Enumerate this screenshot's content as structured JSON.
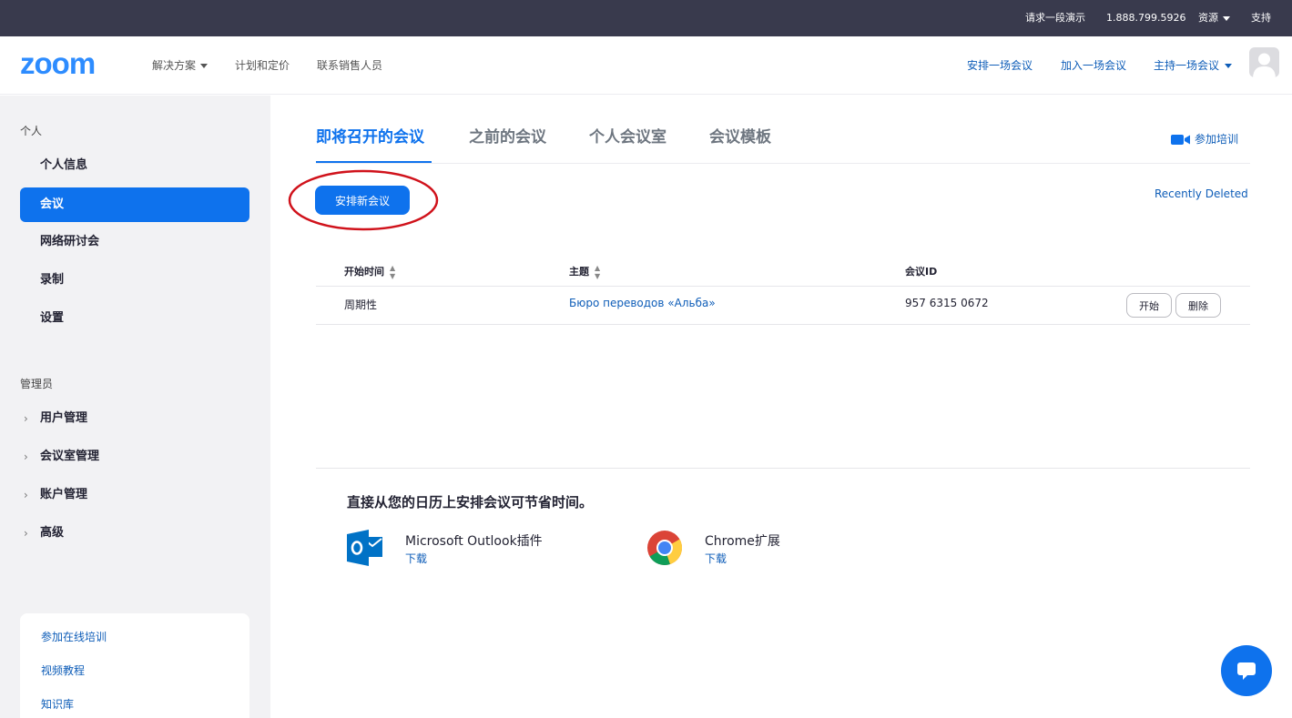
{
  "utility_bar": {
    "request_demo": "请求一段演示",
    "phone": "1.888.799.5926",
    "resources": "资源",
    "support": "支持"
  },
  "header": {
    "logo": "zoom",
    "nav": {
      "solutions": "解决方案",
      "plans": "计划和定价",
      "contact_sales": "联系销售人员"
    },
    "actions": {
      "schedule": "安排一场会议",
      "join": "加入一场会议",
      "host": "主持一场会议"
    }
  },
  "sidebar": {
    "personal_heading": "个人",
    "personal_items": [
      "个人信息",
      "会议",
      "网络研讨会",
      "录制",
      "设置"
    ],
    "active_item": "会议",
    "admin_heading": "管理员",
    "admin_items": [
      "用户管理",
      "会议室管理",
      "账户管理",
      "高级"
    ],
    "links": [
      "参加在线培训",
      "视频教程",
      "知识库"
    ]
  },
  "main": {
    "tabs": [
      "即将召开的会议",
      "之前的会议",
      "个人会议室",
      "会议模板"
    ],
    "active_tab": "即将召开的会议",
    "join_training": "参加培训",
    "schedule_button": "安排新会议",
    "recently_deleted": "Recently Deleted",
    "table": {
      "columns": [
        "开始时间",
        "主题",
        "会议ID"
      ],
      "rows": [
        {
          "start": "周期性",
          "topic": "Бюро переводов «Альба»",
          "meeting_id": "957 6315 0672",
          "start_btn": "开始",
          "delete_btn": "删除"
        }
      ]
    },
    "calendar": {
      "title": "直接从您的日历上安排会议可节省时间。",
      "outlook": {
        "name": "Microsoft Outlook插件",
        "download": "下载"
      },
      "chrome": {
        "name": "Chrome扩展",
        "download": "下载"
      }
    }
  },
  "colors": {
    "brand_blue": "#0e72ed",
    "link_blue": "#0e5db8",
    "topbar": "#393a4d",
    "annotation_red": "#d0121b"
  },
  "icons": [
    "caret-down-icon",
    "avatar-icon",
    "video-camera-icon",
    "sort-icon",
    "chevron-right-icon",
    "outlook-icon",
    "chrome-icon",
    "chat-icon"
  ]
}
